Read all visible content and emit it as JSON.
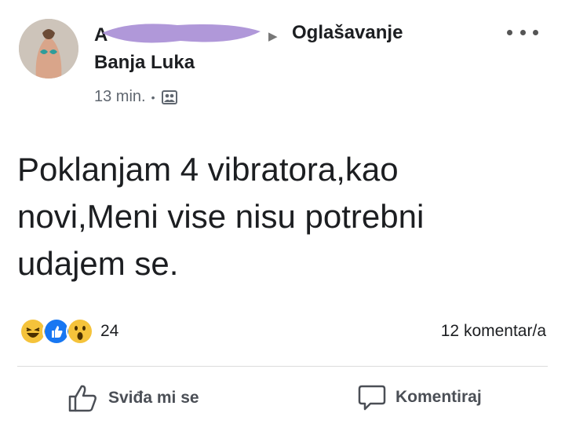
{
  "post": {
    "author": {
      "name": "A"
    },
    "arrow": "▶",
    "group": "Oglašavanje",
    "location": "Banja Luka",
    "time": "13 min.",
    "separator": "•",
    "text": "Poklanjam 4 vibratora,kao novi,Meni vise nisu potrebni udajem se."
  },
  "reactions": {
    "types": [
      "haha",
      "like",
      "wow"
    ],
    "count": "24"
  },
  "comments": {
    "count_label": "12 komentar/a"
  },
  "actions": {
    "like_label": "Sviđa mi se",
    "comment_label": "Komentiraj"
  },
  "colors": {
    "text": "#1c1e21",
    "meta": "#606770",
    "redaction": "#a98fd6",
    "like_blue": "#1877f2",
    "reaction_yellow": "#f5c33b"
  },
  "icons": {
    "more": "more-options-icon",
    "audience": "audience-icon",
    "like": "thumbs-up-icon",
    "comment": "comment-bubble-icon"
  }
}
